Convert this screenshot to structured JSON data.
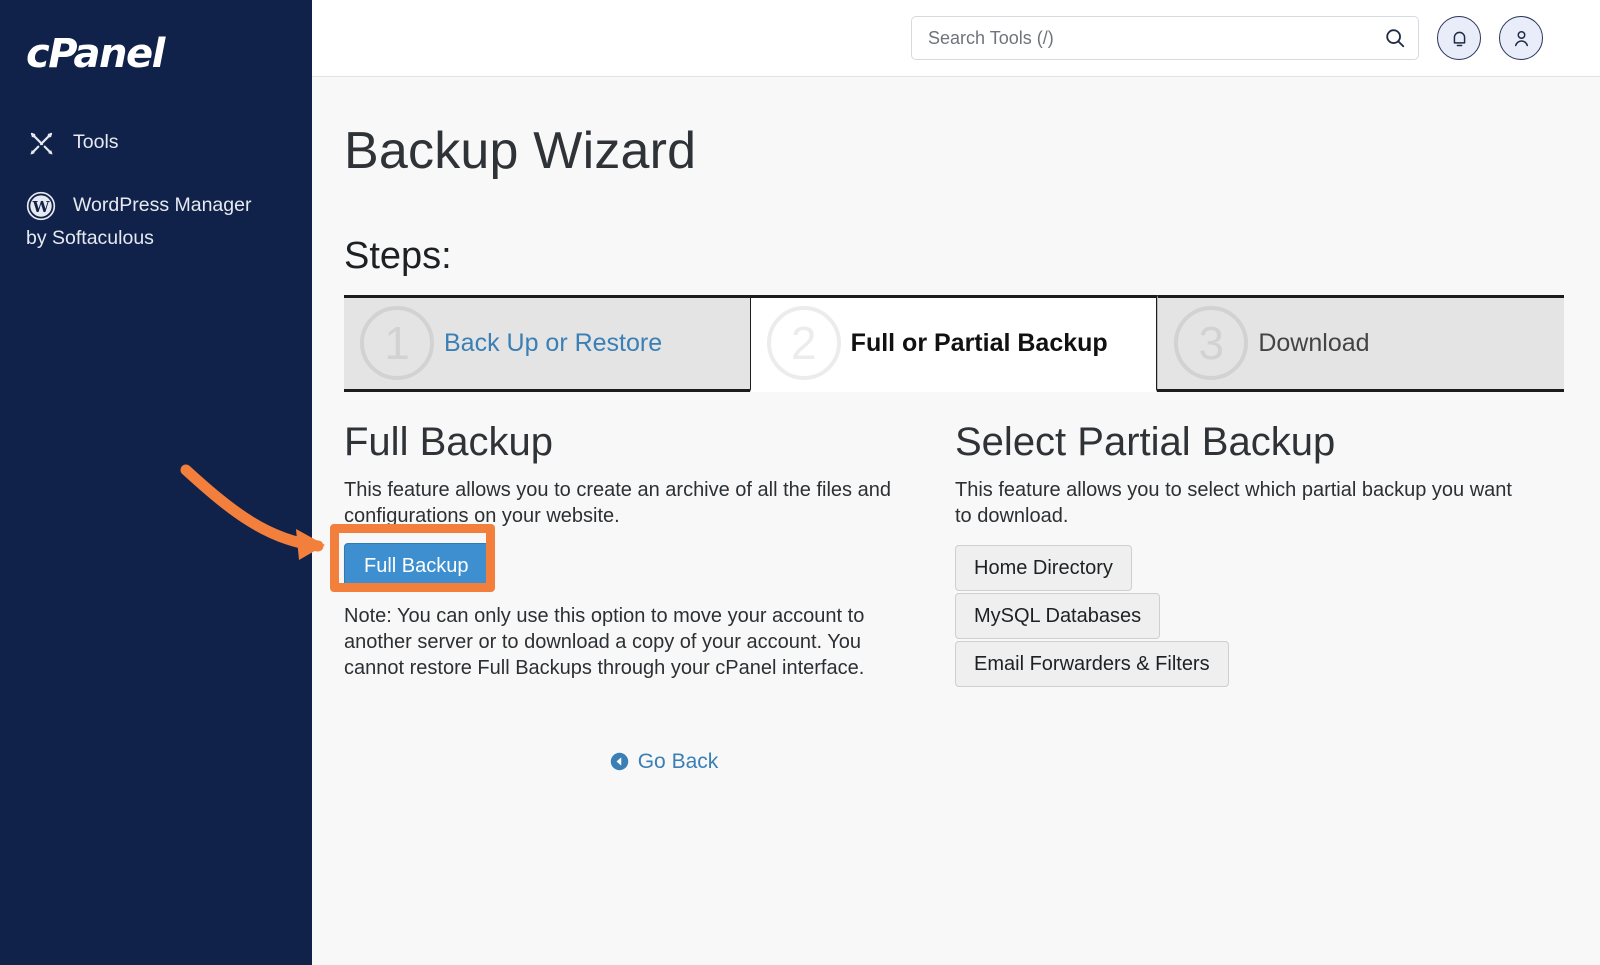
{
  "sidebar": {
    "brand": "cPanel",
    "items": [
      {
        "label": "Tools",
        "icon": "tools-icon"
      },
      {
        "label": "WordPress Manager",
        "sublabel": "by Softaculous",
        "icon": "wordpress-icon"
      }
    ]
  },
  "topbar": {
    "search_placeholder": "Search Tools (/)",
    "search_value": "",
    "search_icon": "search-icon",
    "notifications_icon": "bell-icon",
    "account_icon": "user-icon"
  },
  "page": {
    "title": "Backup Wizard",
    "steps_label": "Steps:"
  },
  "steps": [
    {
      "number": "1",
      "label": "Back Up or Restore",
      "state": "link"
    },
    {
      "number": "2",
      "label": "Full or Partial Backup",
      "state": "active"
    },
    {
      "number": "3",
      "label": "Download",
      "state": "done"
    }
  ],
  "full_backup": {
    "title": "Full Backup",
    "description": "This feature allows you to create an archive of all the files and configurations on your website.",
    "button_label": "Full Backup",
    "note": "Note: You can only use this option to move your account to another server or to download a copy of your account. You cannot restore Full Backups through your cPanel interface."
  },
  "partial_backup": {
    "title": "Select Partial Backup",
    "description": "This feature allows you to select which partial backup you want to download.",
    "buttons": [
      "Home Directory",
      "MySQL Databases",
      "Email Forwarders & Filters"
    ]
  },
  "footer": {
    "go_back_label": "Go Back",
    "go_back_icon": "arrow-circle-left-icon"
  },
  "annotation": {
    "color": "#f2803c",
    "target": "Full Backup"
  }
}
